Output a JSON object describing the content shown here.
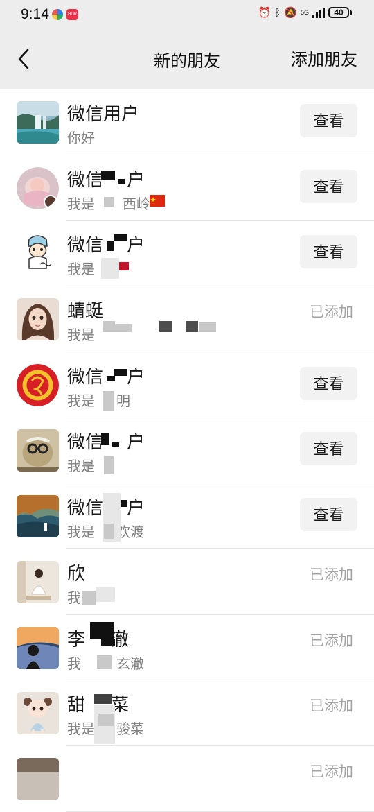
{
  "status_bar": {
    "time": "9:14",
    "app_badge": "HDR",
    "network": "5G",
    "battery": "40"
  },
  "nav": {
    "title": "新的朋友",
    "action_label": "添加朋友"
  },
  "friends": [
    {
      "name": "微信用户",
      "message": "你好",
      "action": "查看"
    },
    {
      "name": "微信",
      "message": "我是",
      "action": "查看"
    },
    {
      "name": "微信",
      "message": "我是",
      "action": "查看"
    },
    {
      "name": "蜻蜓",
      "message": "我是",
      "action": "已添加"
    },
    {
      "name": "微信",
      "message": "我是",
      "action": "查看"
    },
    {
      "name": "微信",
      "message": "我是",
      "action": "查看"
    },
    {
      "name": "微信",
      "message": "我是",
      "action": "查看"
    },
    {
      "name": "欣",
      "message": "我",
      "action": "已添加"
    },
    {
      "name": "李",
      "message": "我",
      "action": "已添加"
    },
    {
      "name": "甜",
      "message": "我是",
      "action": "已添加"
    },
    {
      "name": "",
      "message": "",
      "action": "已添加"
    }
  ],
  "name_tails": [
    "",
    "户",
    "户",
    "",
    "户",
    "户",
    "户",
    "",
    "澈",
    "菜",
    ""
  ],
  "msg_tails": [
    "",
    "西岭",
    "",
    "",
    "明",
    "",
    "欢渡",
    "",
    "玄澈",
    "骏菜",
    ""
  ],
  "colors": {
    "header_bg": "#ededed",
    "button_bg": "#f2f2f2",
    "added_text": "#a3a3a3",
    "secondary_text": "#7f7f7f"
  },
  "icons": {
    "back": "chevron-left-icon",
    "alarm": "alarm-icon",
    "bluetooth": "bluetooth-icon",
    "mute": "bell-off-icon",
    "signal": "signal-icon",
    "battery": "battery-icon"
  }
}
